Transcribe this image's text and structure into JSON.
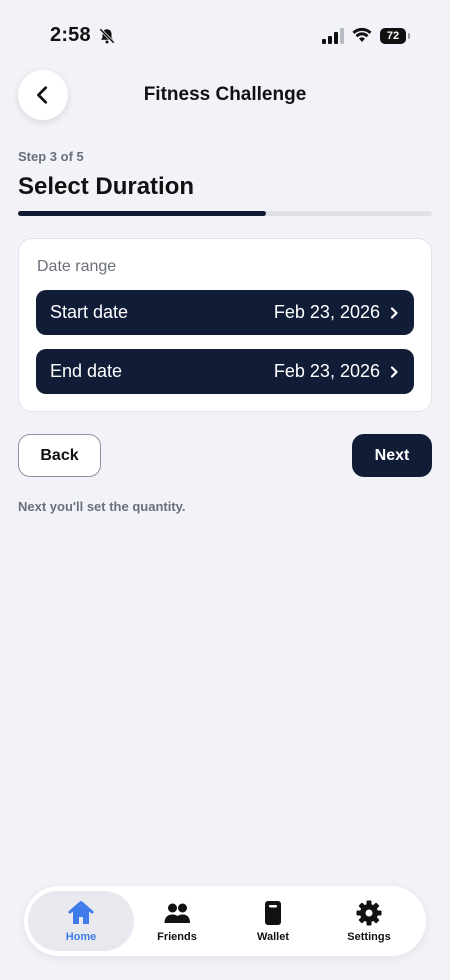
{
  "status_bar": {
    "time": "2:58",
    "battery": "72"
  },
  "header": {
    "title": "Fitness Challenge"
  },
  "step": {
    "label": "Step 3 of 5",
    "title": "Select Duration",
    "progress": 0.6
  },
  "date_range": {
    "label": "Date range",
    "start": {
      "label": "Start date",
      "value": "Feb 23, 2026"
    },
    "end": {
      "label": "End date",
      "value": "Feb 23, 2026"
    }
  },
  "actions": {
    "back_label": "Back",
    "next_label": "Next",
    "hint": "Next you'll set the quantity."
  },
  "tabbar": {
    "accent": "#3f7bea",
    "items": [
      {
        "label": "Home",
        "icon": "home-icon",
        "active": true
      },
      {
        "label": "Friends",
        "icon": "friends-icon",
        "active": false
      },
      {
        "label": "Wallet",
        "icon": "wallet-icon",
        "active": false
      },
      {
        "label": "Settings",
        "icon": "gear-icon",
        "active": false
      }
    ]
  }
}
